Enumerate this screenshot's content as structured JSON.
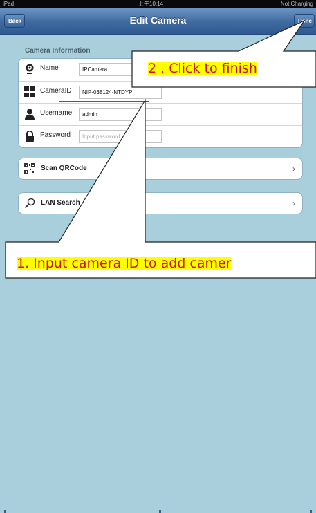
{
  "status_bar": {
    "carrier": "iPad",
    "time": "上午10:14",
    "battery": "Not Charging"
  },
  "nav": {
    "title": "Edit Camera",
    "back_label": "Back",
    "done_label": "Done"
  },
  "camera_info": {
    "section_title": "Camera Information",
    "rows": [
      {
        "label": "Name",
        "value": "IPCamera",
        "placeholder": "",
        "icon": "webcam-icon"
      },
      {
        "label": "CameraID",
        "value": "NIP-038124-NTDYP",
        "placeholder": "",
        "icon": "grid-icon"
      },
      {
        "label": "Username",
        "value": "admin",
        "placeholder": "",
        "icon": "user-icon"
      },
      {
        "label": "Password",
        "value": "",
        "placeholder": "Input password",
        "icon": "lock-icon"
      }
    ]
  },
  "actions": {
    "scan_qrcode": {
      "label": "Scan QRCode",
      "icon": "qrcode-icon"
    },
    "lan_search": {
      "label": "LAN Search",
      "icon": "search-icon"
    }
  },
  "annotations": {
    "step2": "2 . Click to finish",
    "step1": "1. Input camera ID to add camer"
  },
  "colors": {
    "annotation_text": "#d11212",
    "annotation_highlight": "#ffff00",
    "nav_bar": "#3f6aa0",
    "background": "#a9cfdc",
    "highlight_box": "#e31e1e"
  }
}
